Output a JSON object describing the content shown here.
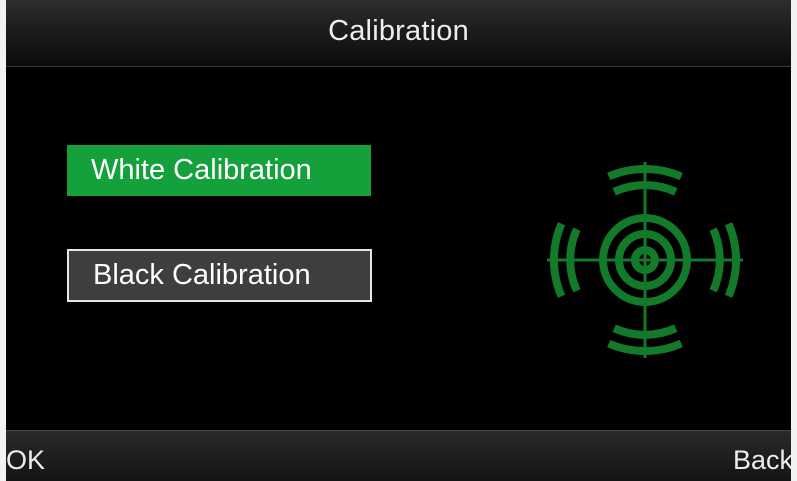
{
  "title": "Calibration",
  "menu": {
    "white_calibration": "White Calibration",
    "black_calibration": "Black Calibration",
    "selected": "White Calibration"
  },
  "softkeys": {
    "left": "OK",
    "right": "Back"
  },
  "icons": {
    "target": "crosshair-target-icon"
  },
  "colors": {
    "selected_bg": "#14a03b",
    "unselected_bg": "#3e3e3e",
    "target_green": "#127a28",
    "background": "#000000"
  }
}
